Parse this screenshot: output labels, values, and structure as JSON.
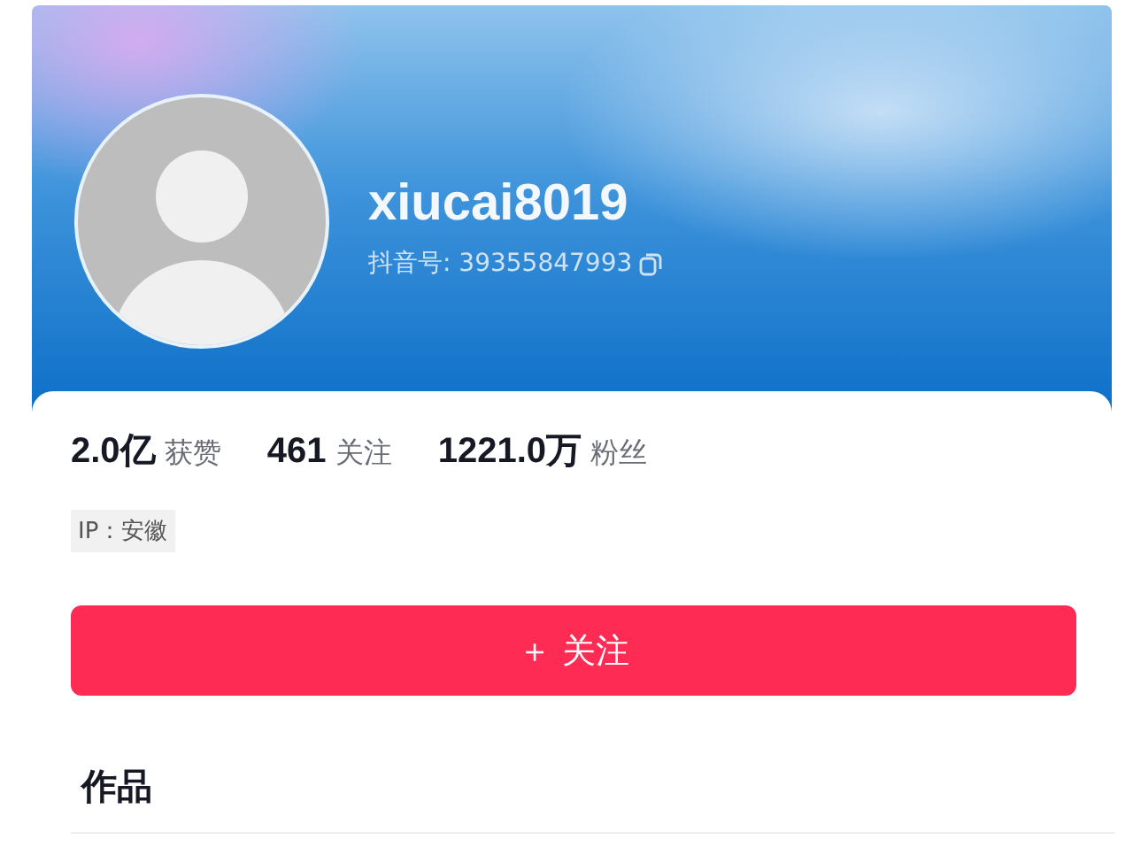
{
  "profile": {
    "username": "xiucai8019",
    "id_label": "抖音号: 39355847993"
  },
  "stats": [
    "**2.0亿** 获赞",
    "**461** 关注",
    "**1221.0万** 粉丝"
  ],
  "ip_tag": "IP：安徽",
  "follow_button": "＋ 关注",
  "section_title": "作品"
}
